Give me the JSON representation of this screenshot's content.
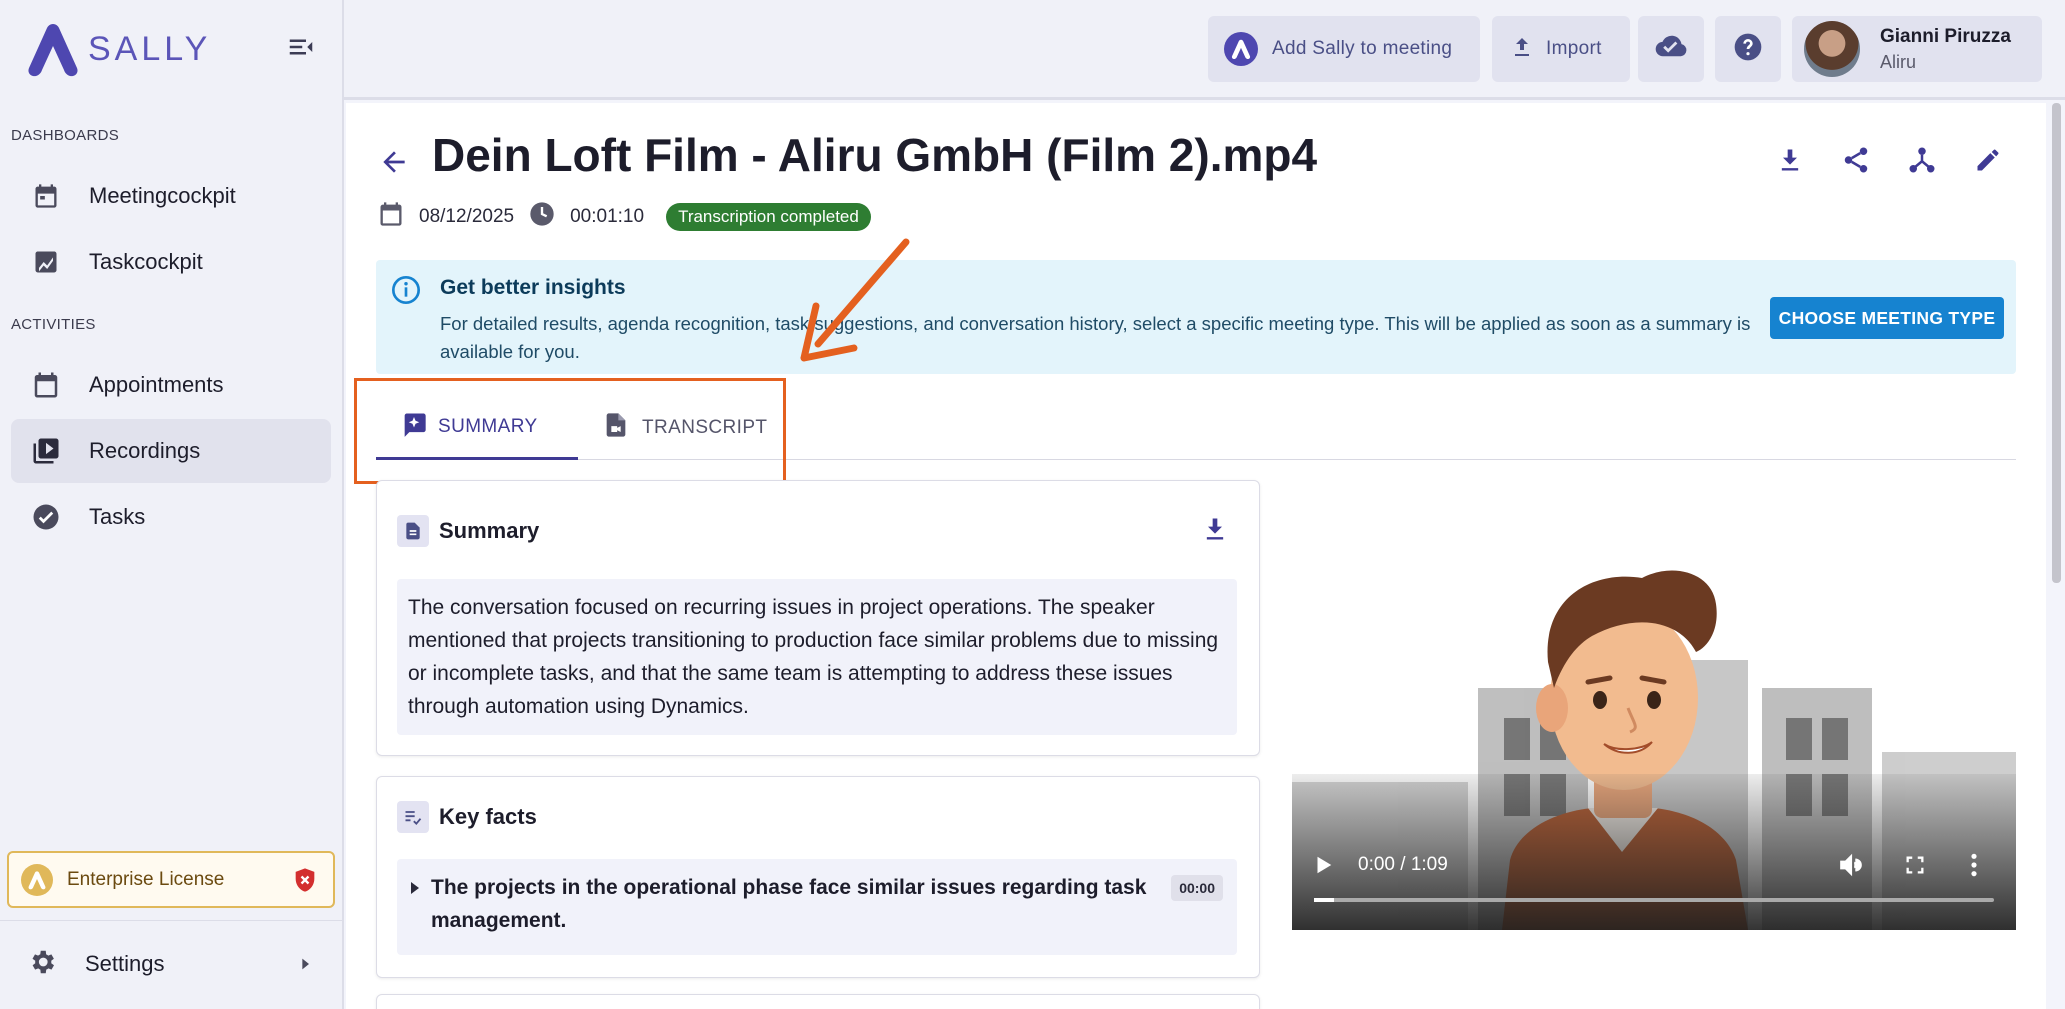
{
  "app": {
    "name": "SALLY"
  },
  "sidebar": {
    "sections": [
      {
        "label": "DASHBOARDS"
      },
      {
        "label": "ACTIVITIES"
      }
    ],
    "items": [
      {
        "label": "Meetingcockpit",
        "icon": "calendar-icon"
      },
      {
        "label": "Taskcockpit",
        "icon": "chart-icon"
      },
      {
        "label": "Appointments",
        "icon": "calendar-icon"
      },
      {
        "label": "Recordings",
        "icon": "video-library-icon",
        "active": true
      },
      {
        "label": "Tasks",
        "icon": "check-circle-icon"
      }
    ],
    "license": "Enterprise License",
    "settings": "Settings"
  },
  "topbar": {
    "add_sally": "Add Sally to meeting",
    "import": "Import",
    "user": {
      "name": "Gianni Piruzza",
      "org": "Aliru"
    }
  },
  "recording": {
    "title": "Dein Loft Film - Aliru GmbH (Film 2).mp4",
    "date": "08/12/2025",
    "duration": "00:01:10",
    "status": "Transcription completed"
  },
  "insight": {
    "title": "Get better insights",
    "text": "For detailed results, agenda recognition, task suggestions, and conversation history, select a specific meeting type. This will be applied as soon as a summary is available for you.",
    "button": "CHOOSE MEETING TYPE"
  },
  "tabs": [
    {
      "label": "SUMMARY",
      "active": true
    },
    {
      "label": "TRANSCRIPT",
      "active": false
    }
  ],
  "summary": {
    "title": "Summary",
    "text": "The conversation focused on recurring issues in project operations. The speaker mentioned that projects transitioning to production face similar problems due to missing or incomplete tasks, and that the same team is attempting to address these issues through automation using Dynamics."
  },
  "key_facts": {
    "title": "Key facts",
    "items": [
      {
        "text": "The projects in the operational phase face similar issues regarding task management.",
        "time": "00:00"
      }
    ]
  },
  "video": {
    "time": "0:00 / 1:09",
    "progress": 0.03
  },
  "colors": {
    "accent": "#3f3a94",
    "info_bg": "#e3f4fb",
    "status_green": "#2e7d32",
    "annotation": "#e4601f"
  }
}
